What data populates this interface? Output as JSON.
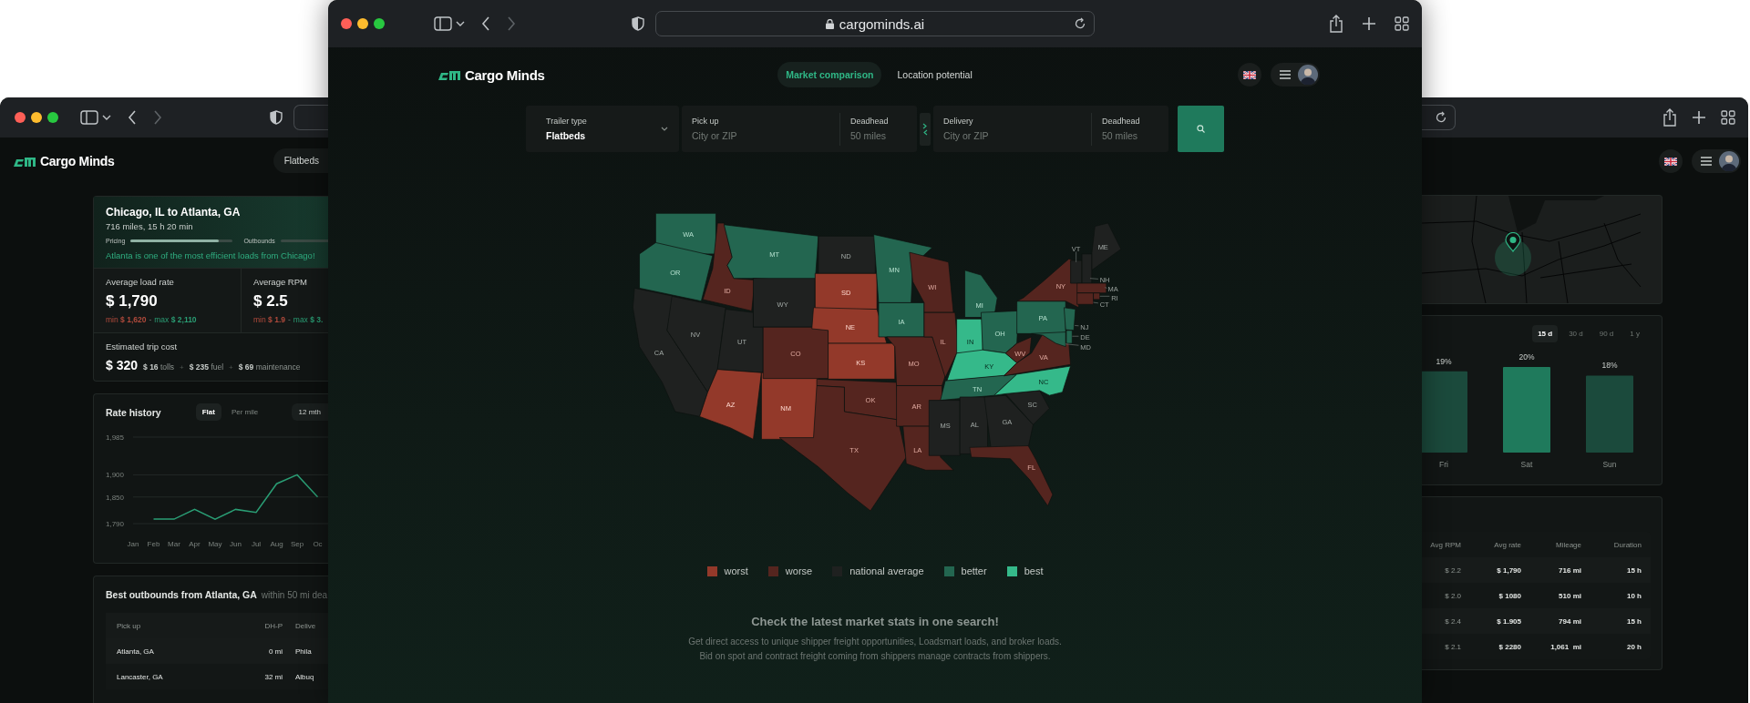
{
  "left_window": {
    "logo": "Cargo Minds",
    "trailer_pill": "Flatbeds",
    "route": {
      "title": "Chicago, IL  to Atlanta, GA",
      "subtitle": "716 miles, 15 h 20 min",
      "meters": [
        {
          "label": "Pricing",
          "level": 0.86
        },
        {
          "label": "Outbounds"
        }
      ],
      "note": "Atlanta is one of the most efficient loads from Chicago!"
    },
    "stats": [
      {
        "label": "Average load rate",
        "value": "$ 1,790",
        "min": "min **$ 1,620**",
        "separator": "-",
        "max": "max **$ 2,110**"
      },
      {
        "label": "Average RPM",
        "value": "$ 2.5",
        "min": "min **$ 1.9**",
        "separator": "-",
        "max": "max **$ 3.**"
      }
    ],
    "trip_cost": {
      "label": "Estimated trip cost",
      "value": "$ 320",
      "separator": "+",
      "parts": [
        "**$ 16** tolls",
        "**$ 235** fuel",
        "**$ 69** maintenance"
      ]
    },
    "rate_history": {
      "title": "Rate history",
      "tabs": [
        {
          "label": "Flat",
          "selected": true
        },
        {
          "label": "Per mile",
          "selected": false
        }
      ],
      "period": "12 mth",
      "chart_data": {
        "type": "line",
        "categories": [
          "Jan",
          "Feb",
          "Mar",
          "Apr",
          "May",
          "Jun",
          "Jul",
          "Aug",
          "Sep",
          "Oc"
        ],
        "values": [
          null,
          1800,
          1800,
          1822,
          1800,
          1822,
          1815,
          1880,
          1900,
          1850
        ],
        "ylim": [
          1790,
          1985
        ],
        "grid": true,
        "yticks": [
          {
            "value": 1790,
            "label": "1,790"
          },
          {
            "value": 1850,
            "label": "1,850"
          },
          {
            "value": 1900,
            "label": "1,900"
          },
          {
            "value": 1985,
            "label": "1,985"
          }
        ]
      }
    },
    "outbounds": {
      "title": "Best outbounds from Atlanta, GA",
      "subtitle": "within 50 mi dea",
      "columns": [
        "Pick up",
        "DH-P",
        "Delive"
      ],
      "rows": [
        [
          "Atlanta, GA",
          "0 mi",
          "Phila"
        ],
        [
          "Lancaster, GA",
          "32 mi",
          "Albuq"
        ]
      ]
    }
  },
  "main_window": {
    "address": "cargominds.ai",
    "logo": "Cargo Minds",
    "nav": [
      {
        "label": "Market comparison",
        "selected": true
      },
      {
        "label": "Location potential",
        "selected": false
      }
    ],
    "search": {
      "trailer": {
        "label": "Trailer type",
        "value": "Flatbeds"
      },
      "pickup": {
        "label": "Pick up",
        "placeholder": "City or ZIP"
      },
      "pickup_deadhead": {
        "label": "Deadhead",
        "placeholder": "50 miles"
      },
      "delivery": {
        "label": "Delivery",
        "placeholder": "City or ZIP"
      },
      "delivery_deadhead": {
        "label": "Deadhead",
        "placeholder": "50 miles"
      }
    },
    "map": {
      "states": [
        {
          "label": "WA",
          "kind": "better"
        },
        {
          "label": "OR",
          "kind": "better"
        },
        {
          "label": "CA",
          "kind": "average"
        },
        {
          "label": "ID",
          "kind": "worse"
        },
        {
          "label": "MT",
          "kind": "better"
        },
        {
          "label": "WY",
          "kind": "average"
        },
        {
          "label": "NV",
          "kind": "average"
        },
        {
          "label": "UT",
          "kind": "average"
        },
        {
          "label": "AZ",
          "kind": "worst"
        },
        {
          "label": "NM",
          "kind": "worst"
        },
        {
          "label": "CO",
          "kind": "worse"
        },
        {
          "label": "ND",
          "kind": "average"
        },
        {
          "label": "SD",
          "kind": "worst"
        },
        {
          "label": "NE",
          "kind": "worst"
        },
        {
          "label": "KS",
          "kind": "worst"
        },
        {
          "label": "OK",
          "kind": "worse"
        },
        {
          "label": "TX",
          "kind": "worse"
        },
        {
          "label": "MN",
          "kind": "better"
        },
        {
          "label": "IA",
          "kind": "better"
        },
        {
          "label": "MO",
          "kind": "worse"
        },
        {
          "label": "AR",
          "kind": "worse"
        },
        {
          "label": "LA",
          "kind": "worse"
        },
        {
          "label": "WI",
          "kind": "worse"
        },
        {
          "label": "IL",
          "kind": "worse"
        },
        {
          "label": "MI",
          "kind": "better"
        },
        {
          "label": "IN",
          "kind": "best"
        },
        {
          "label": "OH",
          "kind": "better"
        },
        {
          "label": "KY",
          "kind": "best"
        },
        {
          "label": "TN",
          "kind": "better"
        },
        {
          "label": "MS",
          "kind": "average"
        },
        {
          "label": "AL",
          "kind": "average"
        },
        {
          "label": "GA",
          "kind": "average"
        },
        {
          "label": "SC",
          "kind": "average"
        },
        {
          "label": "NC",
          "kind": "best"
        },
        {
          "label": "FL",
          "kind": "worse"
        },
        {
          "label": "VA",
          "kind": "worse"
        },
        {
          "label": "WV",
          "kind": "worse"
        },
        {
          "label": "PA",
          "kind": "better"
        },
        {
          "label": "NJ",
          "kind": "better"
        },
        {
          "label": "DE",
          "kind": "better"
        },
        {
          "label": "MD",
          "kind": "better"
        },
        {
          "label": "NY",
          "kind": "worse"
        },
        {
          "label": "VT",
          "kind": "average"
        },
        {
          "label": "ME",
          "kind": "average"
        },
        {
          "label": "NH",
          "kind": "average"
        },
        {
          "label": "MA",
          "kind": "worse"
        },
        {
          "label": "CT",
          "kind": "worse"
        },
        {
          "label": "RI",
          "kind": "worse"
        }
      ]
    },
    "legend": [
      {
        "label": "worst",
        "kind": "worst",
        "color": "#93392a"
      },
      {
        "label": "worse",
        "kind": "worse",
        "color": "#55251f"
      },
      {
        "label": "national average",
        "kind": "average",
        "color": "#1f2120"
      },
      {
        "label": "better",
        "kind": "better",
        "color": "#236650"
      },
      {
        "label": "best",
        "kind": "best",
        "color": "#35b98a"
      }
    ],
    "heading": "Check the latest market stats in one search!",
    "paragraph": [
      "Get direct access to unique shipper freight opportunities, Loadsmart loads, and broker loads.",
      "Bid on spot and contract freight coming from shippers manage contracts from shippers."
    ]
  },
  "right_window": {
    "chart": {
      "tabs": [
        {
          "label": "15 d",
          "selected": true
        },
        {
          "label": "30 d",
          "selected": false
        },
        {
          "label": "90 d",
          "selected": false
        },
        {
          "label": "1 y",
          "selected": false
        }
      ],
      "chart_data": {
        "type": "bar",
        "categories": [
          "Fri",
          "Sat",
          "Sun"
        ],
        "values": [
          19,
          20,
          18
        ],
        "value_labels": [
          "19%",
          "20%",
          "18%"
        ]
      }
    },
    "table": {
      "columns": [
        "Avg RPM",
        "Avg rate",
        "Mileage",
        "Duration"
      ],
      "rows": [
        [
          "$ 2.2",
          "$ 1,790",
          "716 mi",
          "15 h"
        ],
        [
          "$ 2.0",
          "$ 1080",
          "510 mi",
          "10 h"
        ],
        [
          "$ 2.4",
          "$ 1.905",
          "794 mi",
          "15 h"
        ],
        [
          "$ 2.1",
          "$ 2280",
          "1,061  mi",
          "20 h"
        ]
      ]
    }
  }
}
